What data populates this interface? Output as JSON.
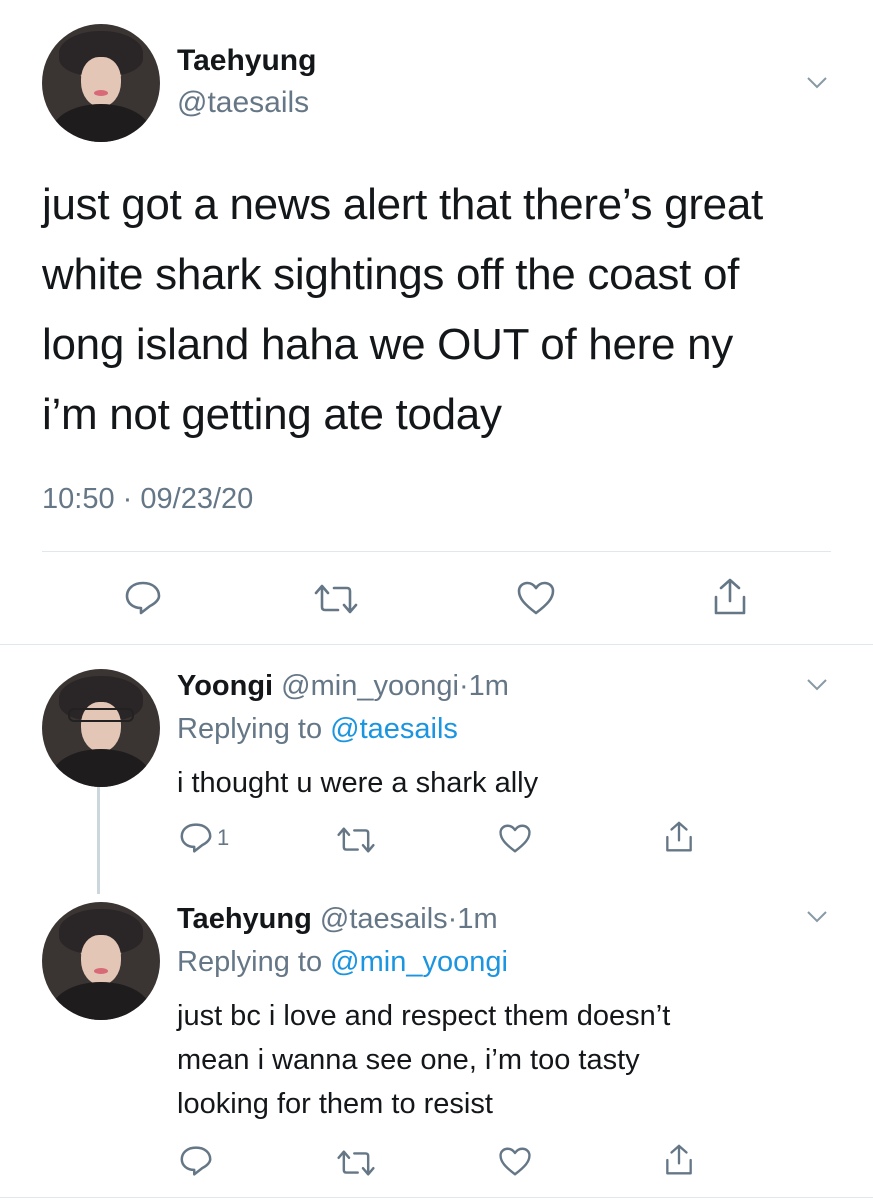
{
  "main_tweet": {
    "display_name": "Taehyung",
    "handle": "@taesails",
    "text_lines": [
      "just got a news alert that there’s great",
      "white shark sightings off the coast of",
      "long island haha we OUT of here ny",
      "i’m not getting ate today"
    ],
    "time": "10:50",
    "date_sep": "·",
    "date": "09/23/20"
  },
  "replies": [
    {
      "display_name": "Yoongi",
      "handle": "@min_yoongi",
      "time_sep": "·",
      "time": "1m",
      "replying_prefix": "Replying to",
      "replying_to": "@taesails",
      "text_lines": [
        "i thought u were a shark ally"
      ],
      "reply_count": "1"
    },
    {
      "display_name": "Taehyung",
      "handle": "@taesails",
      "time_sep": "·",
      "time": "1m",
      "replying_prefix": "Replying to",
      "replying_to": "@min_yoongi",
      "text_lines": [
        "just bc i love and respect them doesn’t",
        "mean i wanna see one, i’m too tasty",
        "looking for them to resist"
      ],
      "reply_count": ""
    }
  ],
  "icons": {
    "reply": "reply-icon",
    "retweet": "retweet-icon",
    "like": "heart-icon",
    "share": "share-icon",
    "more": "chevron-down-icon"
  },
  "colors": {
    "text": "#14171a",
    "muted": "#657786",
    "link": "#1b95e0",
    "divider": "#e1e8ed"
  }
}
